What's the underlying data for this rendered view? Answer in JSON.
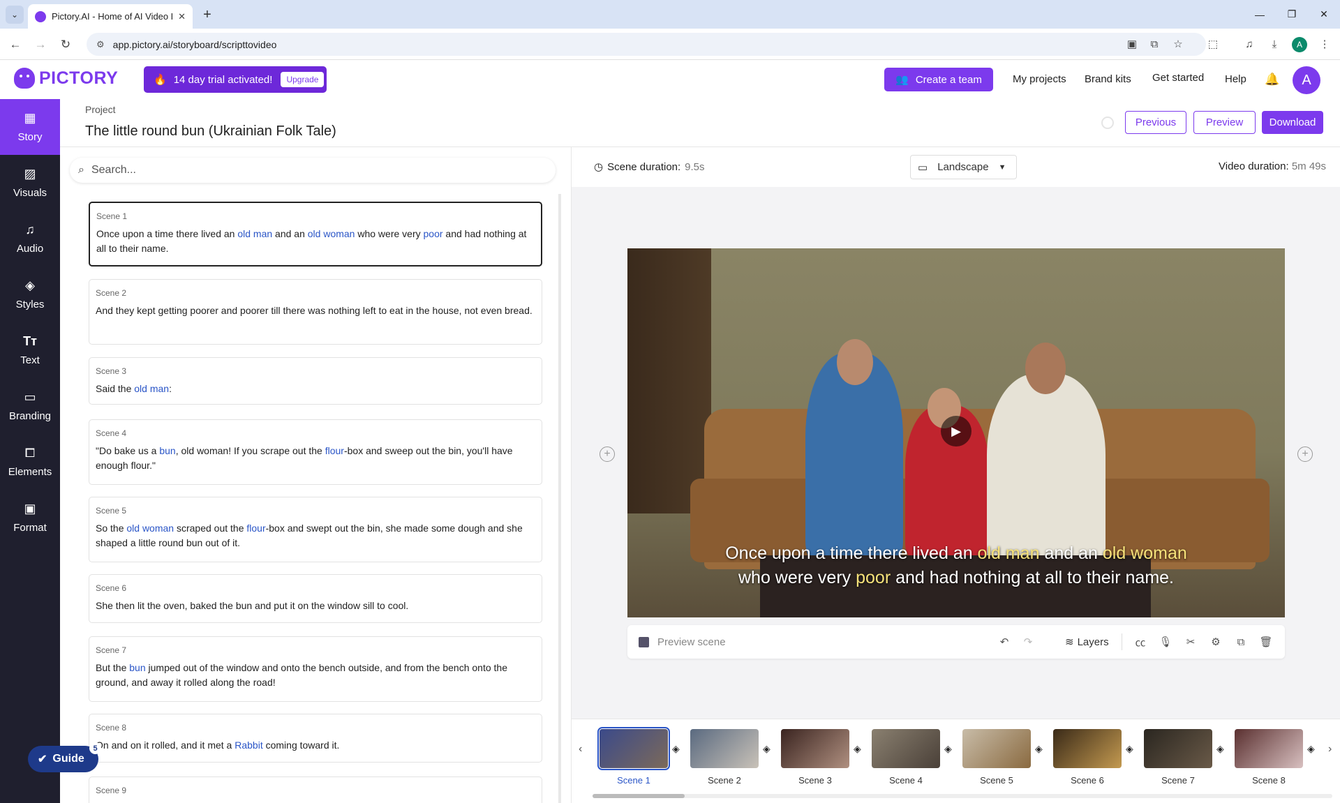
{
  "browser": {
    "tab_title": "Pictory.AI - Home of AI Video E",
    "url": "app.pictory.ai/storyboard/scripttovideo",
    "profile_initial": "A"
  },
  "header": {
    "logo": "PICTORY",
    "trial_text": "14 day trial activated!",
    "upgrade_label": "Upgrade",
    "create_team_label": "Create a team",
    "links": [
      "My projects",
      "Brand kits",
      "Get started",
      "Help"
    ],
    "avatar_initial": "A"
  },
  "rail": {
    "items": [
      {
        "label": "Story",
        "icon": "story-icon"
      },
      {
        "label": "Visuals",
        "icon": "visuals-icon"
      },
      {
        "label": "Audio",
        "icon": "audio-icon"
      },
      {
        "label": "Styles",
        "icon": "styles-icon"
      },
      {
        "label": "Text",
        "icon": "text-icon"
      },
      {
        "label": "Branding",
        "icon": "branding-icon"
      },
      {
        "label": "Elements",
        "icon": "elements-icon"
      },
      {
        "label": "Format",
        "icon": "format-icon"
      }
    ]
  },
  "project": {
    "label": "Project",
    "title": "The little round bun (Ukrainian Folk Tale)",
    "previous_label": "Previous",
    "preview_label": "Preview",
    "download_label": "Download"
  },
  "search": {
    "placeholder": "Search..."
  },
  "scenes": [
    {
      "label": "Scene 1",
      "segments": [
        [
          "Once upon a time there lived an ",
          false
        ],
        [
          "old man",
          true
        ],
        [
          " and an ",
          false
        ],
        [
          "old woman",
          true
        ],
        [
          " who were very ",
          false
        ],
        [
          "poor",
          true
        ],
        [
          " and had nothing at all to their name.",
          false
        ]
      ]
    },
    {
      "label": "Scene 2",
      "segments": [
        [
          "And they kept getting poorer and poorer till there was nothing left to eat in the house, not even bread.",
          false
        ]
      ]
    },
    {
      "label": "Scene 3",
      "segments": [
        [
          "Said the ",
          false
        ],
        [
          "old man",
          true
        ],
        [
          ":",
          false
        ]
      ]
    },
    {
      "label": "Scene 4",
      "segments": [
        [
          "\"Do bake us a ",
          false
        ],
        [
          "bun",
          true
        ],
        [
          ", old woman! If you scrape out the ",
          false
        ],
        [
          "flour",
          true
        ],
        [
          "-box and sweep out the bin, you'll have enough flour.\"",
          false
        ]
      ]
    },
    {
      "label": "Scene 5",
      "segments": [
        [
          "So the ",
          false
        ],
        [
          "old woman",
          true
        ],
        [
          " scraped out the ",
          false
        ],
        [
          "flour",
          true
        ],
        [
          "-box and swept out the bin, she made some dough and she shaped a little round bun out of it.",
          false
        ]
      ]
    },
    {
      "label": "Scene 6",
      "segments": [
        [
          "She then lit the oven, baked the bun and put it on the window sill to cool.",
          false
        ]
      ]
    },
    {
      "label": "Scene 7",
      "segments": [
        [
          "But the ",
          false
        ],
        [
          "bun",
          true
        ],
        [
          " jumped out of the window and onto the bench outside, and from the bench onto the ground, and away it rolled along the road!",
          false
        ]
      ]
    },
    {
      "label": "Scene 8",
      "segments": [
        [
          "On and on it rolled, and it met a ",
          false
        ],
        [
          "Rabbit",
          true
        ],
        [
          " coming toward it.",
          false
        ]
      ]
    },
    {
      "label": "Scene 9",
      "segments": []
    }
  ],
  "editor": {
    "scene_duration_label": "Scene duration:",
    "scene_duration_value": "9.5s",
    "orientation": "Landscape",
    "video_duration_label": "Video duration:",
    "video_duration_value": "5m 49s",
    "caption": {
      "line1": [
        [
          "Once upon a time there lived an ",
          false
        ],
        [
          "old man",
          true
        ],
        [
          " and an ",
          false
        ],
        [
          "old woman",
          true
        ]
      ],
      "line2": [
        [
          "who were very ",
          false
        ],
        [
          "poor",
          true
        ],
        [
          " and had nothing at all to their name.",
          false
        ]
      ]
    },
    "toolbar": {
      "preview_scene_label": "Preview scene",
      "layers_label": "Layers"
    }
  },
  "timeline": {
    "scenes": [
      "Scene 1",
      "Scene 2",
      "Scene 3",
      "Scene 4",
      "Scene 5",
      "Scene 6",
      "Scene 7",
      "Scene 8"
    ],
    "selected": "Scene 1"
  },
  "guide": {
    "label": "Guide",
    "badge": "5"
  },
  "colors": {
    "brand": "#7c3aed",
    "keyword": "#2a55c7",
    "rail_bg": "#1f1f2e"
  }
}
